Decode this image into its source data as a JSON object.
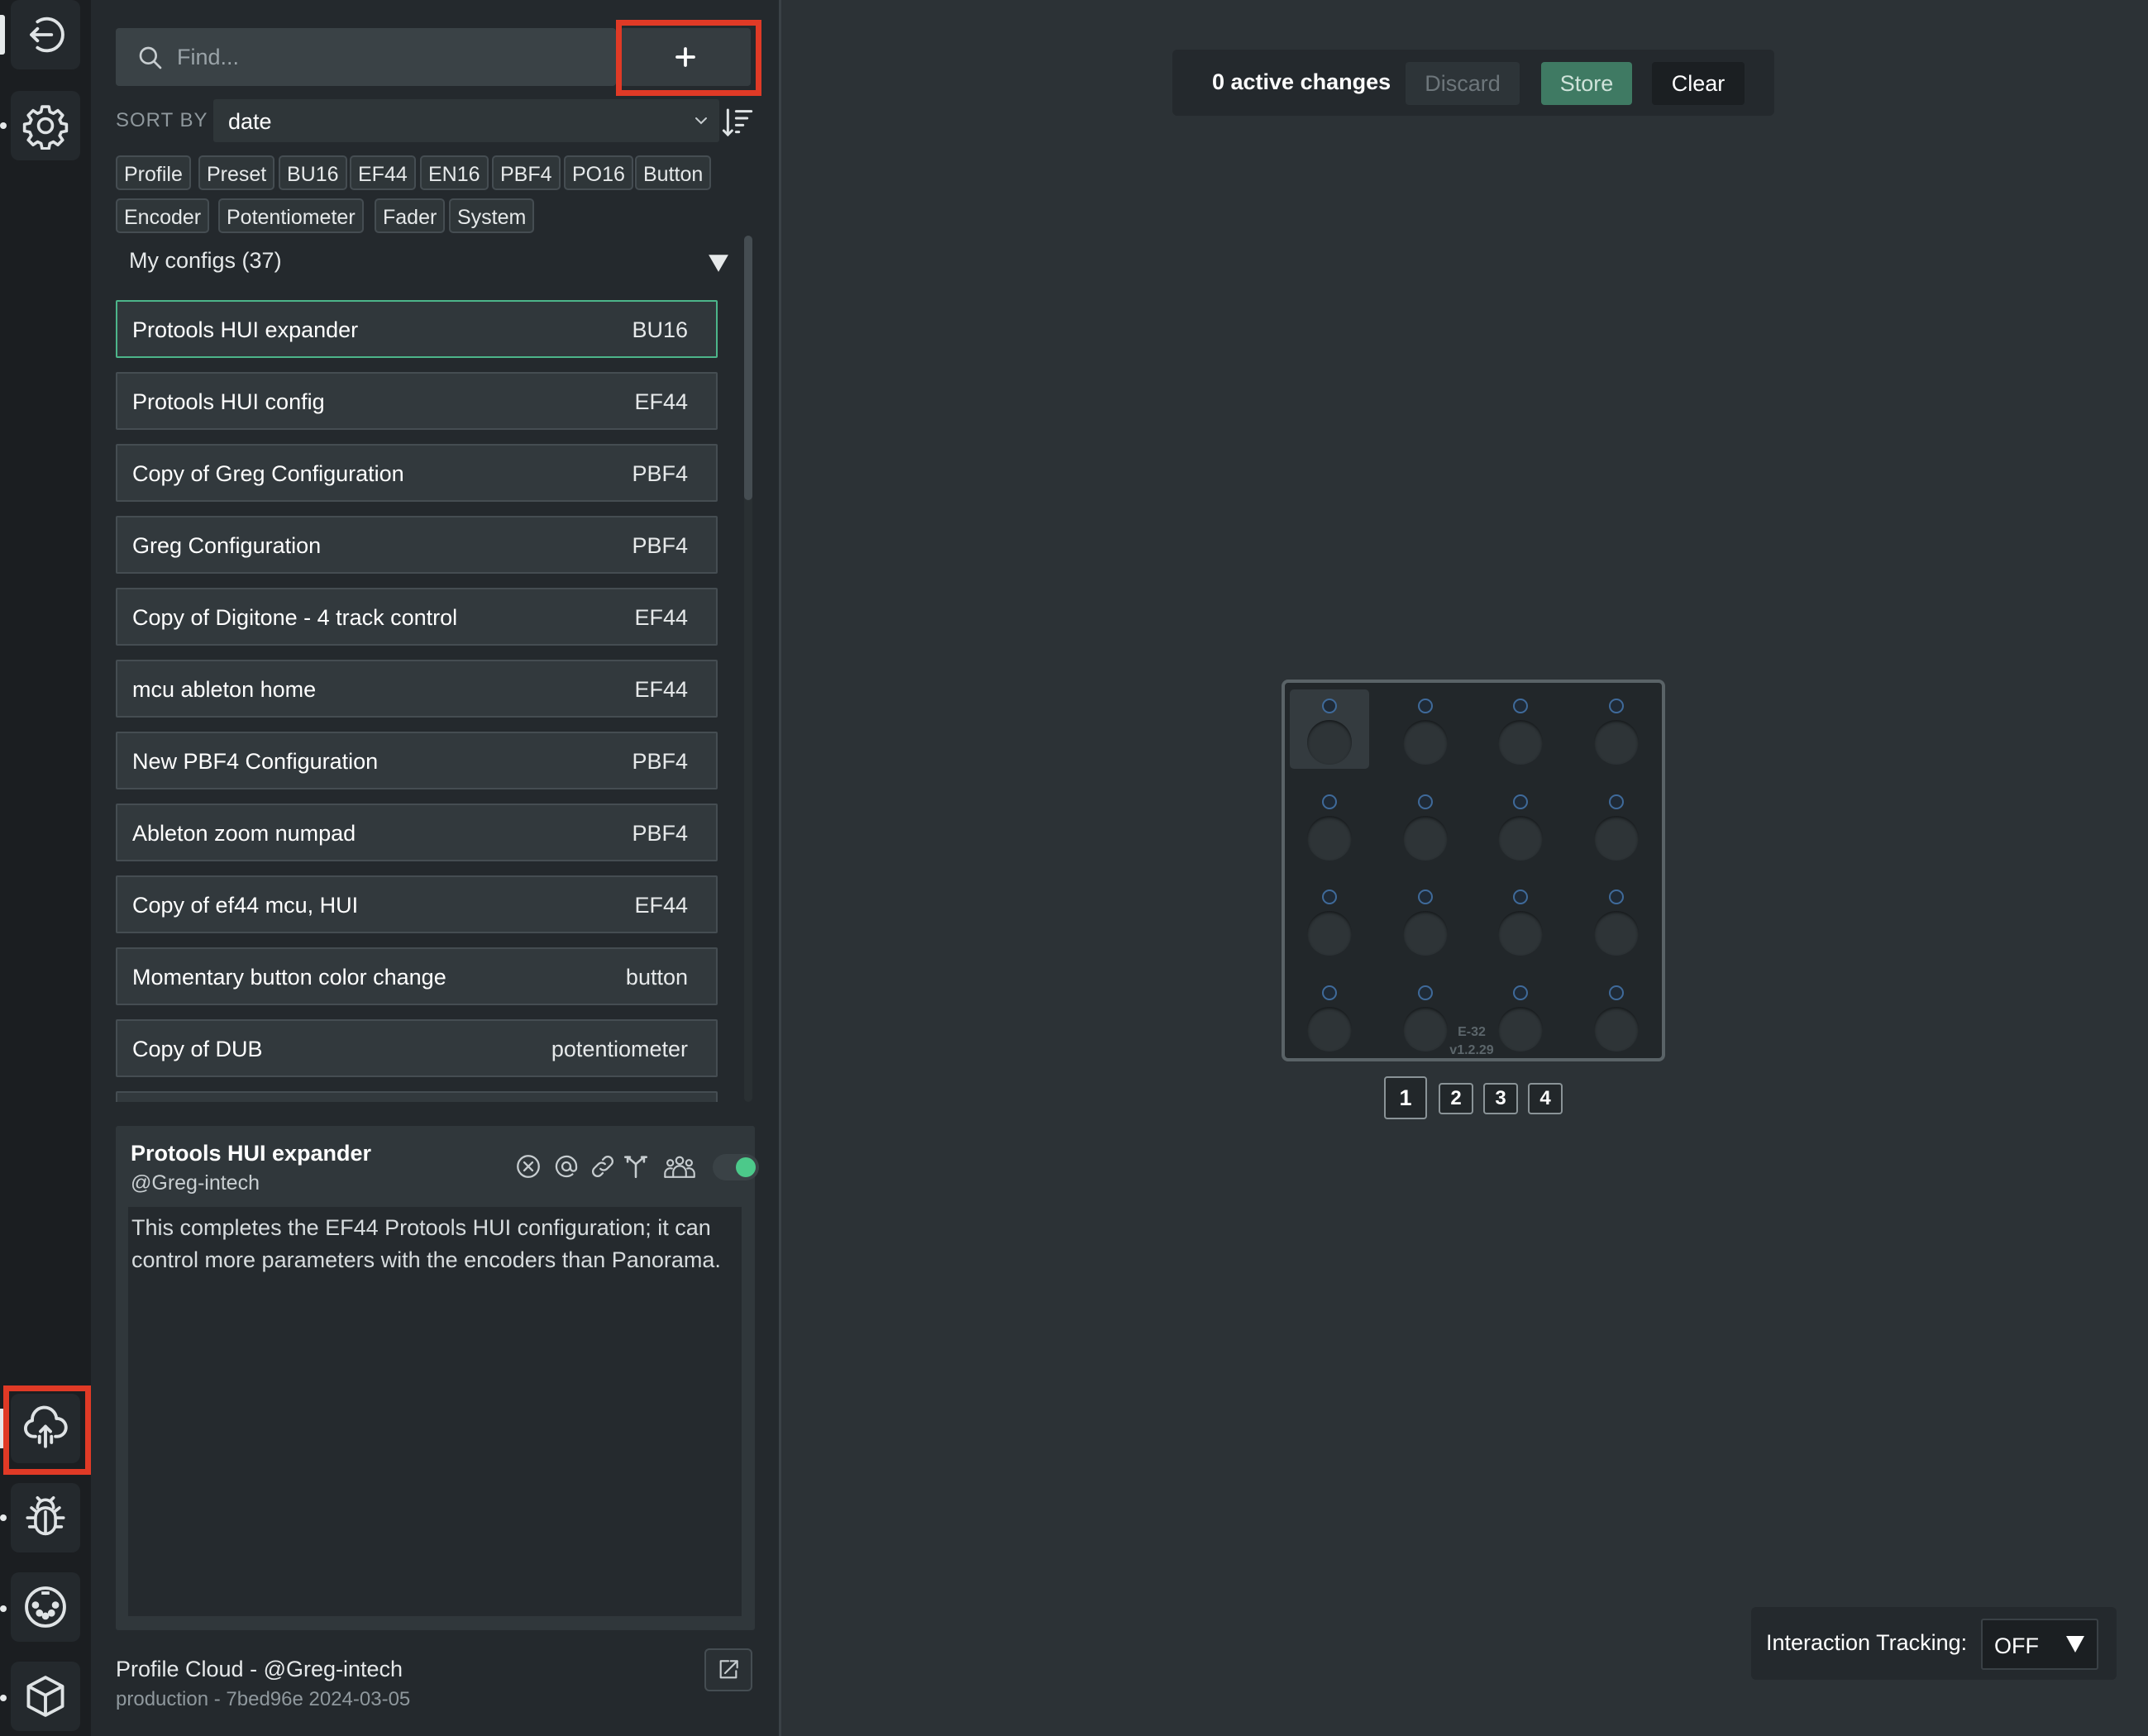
{
  "search": {
    "placeholder": "Find..."
  },
  "sort": {
    "label": "SORT BY",
    "value": "date"
  },
  "tags": [
    "Profile",
    "Preset",
    "BU16",
    "EF44",
    "EN16",
    "PBF4",
    "PO16",
    "Button",
    "Encoder",
    "Potentiometer",
    "Fader",
    "System"
  ],
  "group": {
    "title": "My configs (37)"
  },
  "configs": [
    {
      "name": "Protools HUI expander",
      "type": "BU16"
    },
    {
      "name": "Protools HUI config",
      "type": "EF44"
    },
    {
      "name": "Copy of Greg Configuration",
      "type": "PBF4"
    },
    {
      "name": "Greg Configuration",
      "type": "PBF4"
    },
    {
      "name": "Copy of Digitone - 4 track control",
      "type": "EF44"
    },
    {
      "name": "mcu ableton home",
      "type": "EF44"
    },
    {
      "name": "New PBF4 Configuration",
      "type": "PBF4"
    },
    {
      "name": "Ableton zoom numpad",
      "type": "PBF4"
    },
    {
      "name": "Copy of ef44 mcu, HUI",
      "type": "EF44"
    },
    {
      "name": "Momentary button color change",
      "type": "button"
    },
    {
      "name": "Copy of DUB",
      "type": "potentiometer"
    }
  ],
  "detail": {
    "title": "Protools HUI expander",
    "author": "@Greg-intech",
    "description": "This completes the EF44 Protools HUI configuration; it can control more parameters with the encoders than Panorama.",
    "toggle_on": true
  },
  "footer": {
    "cloud": "Profile Cloud - @Greg-intech",
    "version": "production - 7bed96e 2024-03-05"
  },
  "changes": {
    "text": "0 active changes",
    "discard": "Discard",
    "store": "Store",
    "clear": "Clear"
  },
  "device": {
    "model": "E-32",
    "version": "v1.2.29",
    "active_cell": 0
  },
  "pages": {
    "items": [
      "1",
      "2",
      "3",
      "4"
    ],
    "active": "1"
  },
  "tracking": {
    "label": "Interaction Tracking:",
    "value": "OFF"
  },
  "colors": {
    "accent": "#4cb58a",
    "store": "#3f7a63",
    "highlight_box": "#e03a26",
    "toggle": "#4cc98a"
  },
  "icons": {
    "rail": [
      "logout-icon",
      "settings-gear-icon",
      "cloud-icon",
      "debug-bug-icon",
      "midi-port-icon",
      "package-box-icon"
    ],
    "detail_actions": [
      "remove-icon",
      "at-icon",
      "link-icon",
      "branch-icon",
      "community-icon"
    ]
  }
}
